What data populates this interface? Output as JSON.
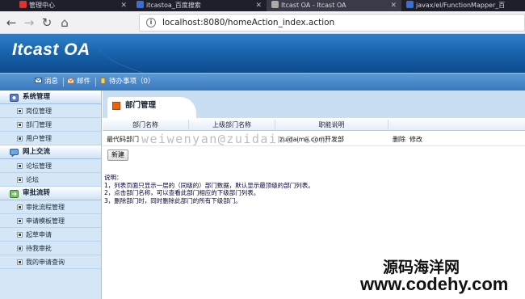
{
  "browser": {
    "tabs": [
      {
        "title": "管理中心",
        "icon_color": "#d33"
      },
      {
        "title": "itcastoa_百度搜索",
        "icon_color": "#3a6fd8"
      },
      {
        "title": "Itcast OA - Itcast OA",
        "icon_color": "#aaaaaa"
      },
      {
        "title": "javax/el/FunctionMapper_百",
        "icon_color": "#3a6fd8"
      }
    ],
    "url": "localhost:8080/homeAction_index.action"
  },
  "app": {
    "logo": "Itcast OA",
    "toolbar": {
      "messages": "消息",
      "mail": "邮件",
      "todo": "待办事项（0）"
    }
  },
  "sidebar": {
    "groups": [
      {
        "title": "系统管理",
        "icon": "gear-icon",
        "items": [
          "岗位管理",
          "部门管理",
          "用户管理"
        ]
      },
      {
        "title": "网上交流",
        "icon": "chat-icon",
        "items": [
          "论坛管理",
          "论坛"
        ]
      },
      {
        "title": "审批流转",
        "icon": "flow-icon",
        "items": [
          "审批流程管理",
          "申请模板管理",
          "起草申请",
          "待我审批",
          "我的申请查询"
        ]
      }
    ]
  },
  "main": {
    "title": "部门管理",
    "columns": [
      "部门名称",
      "上级部门名称",
      "职能说明",
      ""
    ],
    "rows": [
      {
        "name": "最代码部门",
        "parent": "",
        "desc": "zuidaima.com开发部",
        "actions": [
          "删除",
          "修改"
        ]
      }
    ],
    "new_button": "新建",
    "notes": [
      "说明：",
      "1，列表页面只显示一层的（同级的）部门数据，默认显示最顶级的部门列表。",
      "2，点击部门名称，可以查看此部门相应的下级部门列表。",
      "3，删除部门时，同时删除此部门的所有下级部门。"
    ]
  },
  "watermarks": {
    "center": "weiwenyan@zuidaima.com",
    "corner_cn": "源码海洋网",
    "corner_url": "www.codehy.com"
  }
}
